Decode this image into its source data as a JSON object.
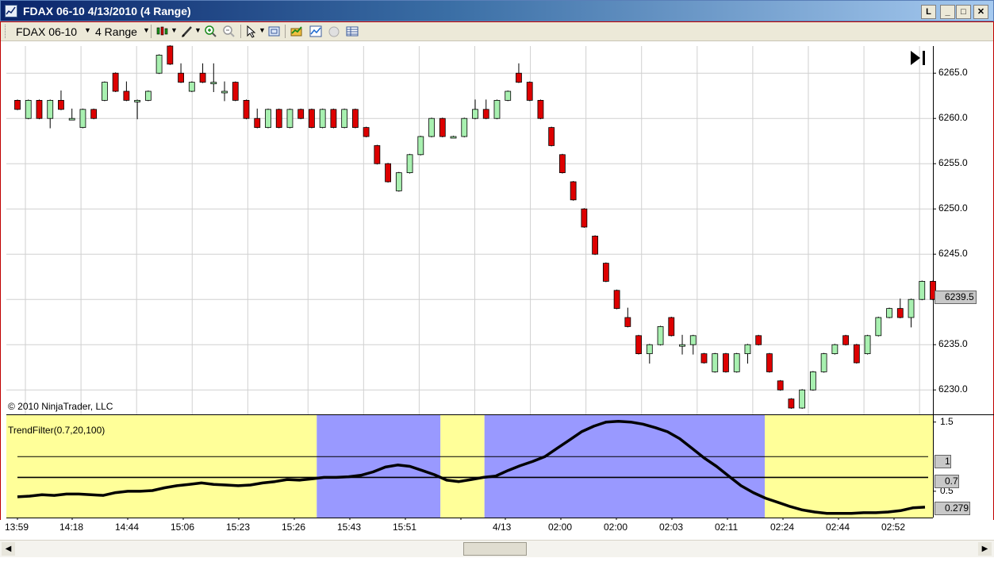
{
  "window": {
    "title": "FDAX 06-10  4/13/2010 (4 Range)",
    "buttons": [
      "L",
      "_",
      "□",
      "✕"
    ]
  },
  "toolbar": {
    "instrument": "FDAX 06-10",
    "interval": "4 Range",
    "icons": [
      "bar-style-icon",
      "drawing-tool-icon",
      "zoom-in-icon",
      "zoom-out-icon",
      "pointer-icon",
      "properties-icon",
      "strategy-icon",
      "indicator-icon",
      "circle-icon",
      "data-box-icon"
    ]
  },
  "chart": {
    "copyright": "© 2010 NinjaTrader, LLC",
    "indicator_label": "TrendFilter(0.7,20,100)",
    "price_marker": "6239.5",
    "ind_markers": [
      "1",
      "0.7",
      "0.279"
    ],
    "colors": {
      "up": "#a8f0b0",
      "down": "#dd0000",
      "zone_yellow": "#ffff99",
      "zone_blue": "#9999ff",
      "grid": "#d0d0d0"
    }
  },
  "chart_data": {
    "type": "candlestick",
    "ylim": [
      6227.3,
      6268.0
    ],
    "y_ticks": [
      "6265.0",
      "6260.0",
      "6255.0",
      "6250.0",
      "6245.0",
      "6240.0",
      "6235.0",
      "6230.0"
    ],
    "x_ticks": [
      "13:59",
      "14:18",
      "14:44",
      "15:06",
      "15:23",
      "15:26",
      "15:43",
      "15:51",
      "4/13",
      "02:00",
      "02:00",
      "02:03",
      "02:11",
      "02:24",
      "02:44",
      "02:52"
    ],
    "candles": [
      [
        6262,
        6262,
        6261,
        6261
      ],
      [
        6260,
        6262,
        6260,
        6262
      ],
      [
        6262,
        6262,
        6260,
        6260
      ],
      [
        6260,
        6262,
        6259,
        6262
      ],
      [
        6262,
        6263,
        6261,
        6261
      ],
      [
        6260,
        6261,
        6260,
        6260
      ],
      [
        6259,
        6261,
        6259,
        6261
      ],
      [
        6261,
        6261,
        6260,
        6260
      ],
      [
        6262,
        6264,
        6262,
        6264
      ],
      [
        6265,
        6265,
        6263,
        6263
      ],
      [
        6263,
        6264,
        6262,
        6262
      ],
      [
        6262,
        6262,
        6260,
        6262
      ],
      [
        6262,
        6263,
        6262,
        6263
      ],
      [
        6265,
        6267,
        6265,
        6267
      ],
      [
        6268,
        6268,
        6266,
        6266
      ],
      [
        6265,
        6266,
        6264,
        6264
      ],
      [
        6263,
        6264,
        6263,
        6264
      ],
      [
        6265,
        6266,
        6264,
        6264
      ],
      [
        6264,
        6266,
        6263,
        6264
      ],
      [
        6263,
        6264,
        6262,
        6263
      ],
      [
        6264,
        6264,
        6262,
        6262
      ],
      [
        6262,
        6262,
        6260,
        6260
      ],
      [
        6260,
        6261,
        6259,
        6259
      ],
      [
        6259,
        6261,
        6259,
        6261
      ],
      [
        6261,
        6261,
        6259,
        6259
      ],
      [
        6259,
        6261,
        6259,
        6261
      ],
      [
        6261,
        6261,
        6260,
        6260
      ],
      [
        6261,
        6261,
        6259,
        6259
      ],
      [
        6259,
        6261,
        6259,
        6261
      ],
      [
        6261,
        6261,
        6259,
        6259
      ],
      [
        6259,
        6261,
        6259,
        6261
      ],
      [
        6261,
        6261,
        6259,
        6259
      ],
      [
        6259,
        6259,
        6258,
        6258
      ],
      [
        6257,
        6257,
        6255,
        6255
      ],
      [
        6255,
        6255,
        6253,
        6253
      ],
      [
        6252,
        6254,
        6252,
        6254
      ],
      [
        6254,
        6256,
        6254,
        6256
      ],
      [
        6256,
        6258,
        6256,
        6258
      ],
      [
        6258,
        6260,
        6258,
        6260
      ],
      [
        6260,
        6260,
        6258,
        6258
      ],
      [
        6258,
        6258,
        6258,
        6258
      ],
      [
        6258,
        6260,
        6258,
        6260
      ],
      [
        6260,
        6262,
        6260,
        6261
      ],
      [
        6261,
        6262,
        6260,
        6260
      ],
      [
        6260,
        6262,
        6260,
        6262
      ],
      [
        6262,
        6263,
        6262,
        6263
      ],
      [
        6265,
        6266,
        6264,
        6264
      ],
      [
        6264,
        6264,
        6262,
        6262
      ],
      [
        6262,
        6262,
        6260,
        6260
      ],
      [
        6259,
        6259,
        6257,
        6257
      ],
      [
        6256,
        6256,
        6254,
        6254
      ],
      [
        6253,
        6253,
        6251,
        6251
      ],
      [
        6250,
        6250,
        6248,
        6248
      ],
      [
        6247,
        6247,
        6245,
        6245
      ],
      [
        6244,
        6244,
        6242,
        6242
      ],
      [
        6241,
        6241,
        6239,
        6239
      ],
      [
        6238,
        6239,
        6237,
        6237
      ],
      [
        6236,
        6236,
        6234,
        6234
      ],
      [
        6234,
        6235,
        6233,
        6235
      ],
      [
        6235,
        6237,
        6235,
        6237
      ],
      [
        6238,
        6238,
        6236,
        6236
      ],
      [
        6235,
        6236,
        6234,
        6235
      ],
      [
        6235,
        6236,
        6234,
        6236
      ],
      [
        6234,
        6234,
        6233,
        6233
      ],
      [
        6232,
        6234,
        6232,
        6234
      ],
      [
        6234,
        6234,
        6232,
        6232
      ],
      [
        6232,
        6234,
        6232,
        6234
      ],
      [
        6234,
        6235,
        6233,
        6235
      ],
      [
        6236,
        6236,
        6235,
        6235
      ],
      [
        6234,
        6234,
        6232,
        6232
      ],
      [
        6231,
        6231,
        6230,
        6230
      ],
      [
        6229,
        6229,
        6228,
        6228
      ],
      [
        6228,
        6230,
        6228,
        6230
      ],
      [
        6230,
        6232,
        6230,
        6232
      ],
      [
        6232,
        6234,
        6232,
        6234
      ],
      [
        6234,
        6235,
        6234,
        6235
      ],
      [
        6236,
        6236,
        6235,
        6235
      ],
      [
        6235,
        6235,
        6233,
        6233
      ],
      [
        6234,
        6236,
        6234,
        6236
      ],
      [
        6236,
        6238,
        6236,
        6238
      ],
      [
        6238,
        6239,
        6238,
        6239
      ],
      [
        6239,
        6240,
        6238,
        6238
      ],
      [
        6238,
        6240,
        6237,
        6240
      ],
      [
        6240,
        6242,
        6240,
        6242
      ],
      [
        6242,
        6242,
        6240,
        6240
      ]
    ],
    "indicator": {
      "ylim": [
        0.12,
        1.6
      ],
      "y_ticks": [
        "1.5",
        "0.5"
      ],
      "levels": [
        1.0,
        0.7
      ],
      "zones": [
        {
          "color": "yellow",
          "from": 0,
          "to": 0.335
        },
        {
          "color": "blue",
          "from": 0.335,
          "to": 0.4685
        },
        {
          "color": "yellow",
          "from": 0.4685,
          "to": 0.516
        },
        {
          "color": "blue",
          "from": 0.516,
          "to": 0.8185
        },
        {
          "color": "yellow",
          "from": 0.8185,
          "to": 1.0
        }
      ],
      "values": [
        0.42,
        0.43,
        0.45,
        0.44,
        0.46,
        0.46,
        0.45,
        0.44,
        0.48,
        0.5,
        0.5,
        0.51,
        0.55,
        0.58,
        0.6,
        0.62,
        0.6,
        0.59,
        0.58,
        0.59,
        0.62,
        0.64,
        0.67,
        0.66,
        0.68,
        0.7,
        0.7,
        0.71,
        0.73,
        0.78,
        0.85,
        0.88,
        0.86,
        0.8,
        0.74,
        0.66,
        0.64,
        0.67,
        0.7,
        0.72,
        0.8,
        0.87,
        0.93,
        1.0,
        1.12,
        1.24,
        1.36,
        1.44,
        1.5,
        1.51,
        1.5,
        1.47,
        1.42,
        1.36,
        1.26,
        1.12,
        0.98,
        0.86,
        0.72,
        0.58,
        0.48,
        0.4,
        0.34,
        0.28,
        0.23,
        0.2,
        0.18,
        0.18,
        0.18,
        0.19,
        0.19,
        0.2,
        0.22,
        0.26,
        0.27
      ]
    }
  }
}
